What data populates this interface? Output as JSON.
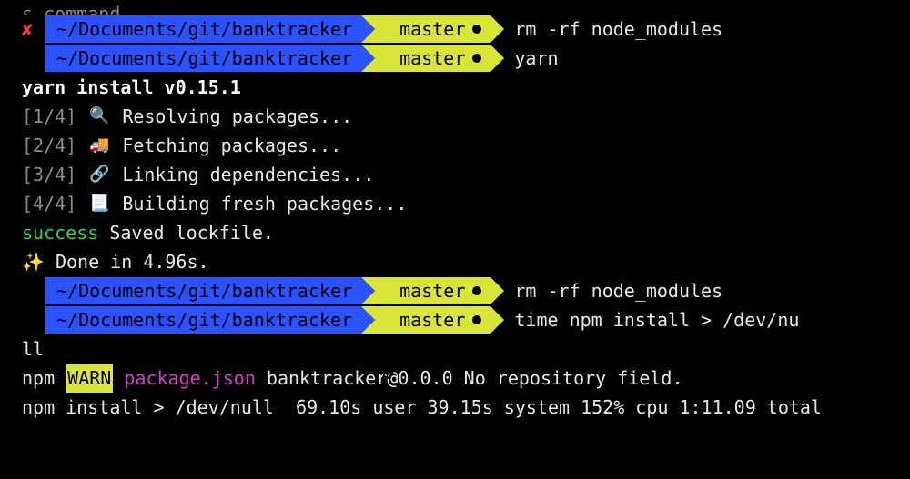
{
  "top_line": "s command.",
  "prompt_path": "~/Documents/git/banktracker",
  "prompt_branch": "master",
  "cmd1": "rm -rf node_modules",
  "cmd2": "yarn",
  "yarn_header": "yarn install v0.15.1",
  "step1_num": "[1/4]",
  "step1_text": "Resolving packages...",
  "step2_num": "[2/4]",
  "step2_text": "Fetching packages...",
  "step3_num": "[3/4]",
  "step3_text": "Linking dependencies...",
  "step4_num": "[4/4]",
  "step4_text": "Building fresh packages...",
  "success_label": "success",
  "success_text": " Saved lockfile.",
  "done_text": " Done in 4.96s.",
  "cmd3": "rm -rf node_modules",
  "cmd4": "time npm install > /dev/nu",
  "wrap_tail": "ll",
  "npm_line1_a": "npm ",
  "npm_line1_warn": "WARN",
  "npm_line1_pkg": " package.json",
  "npm_line1_rest": " banktracker@0.0.0 No repository field.",
  "npm_line2": "npm install > /dev/null  69.10s user 39.15s system 152% cpu 1:11.09 total"
}
